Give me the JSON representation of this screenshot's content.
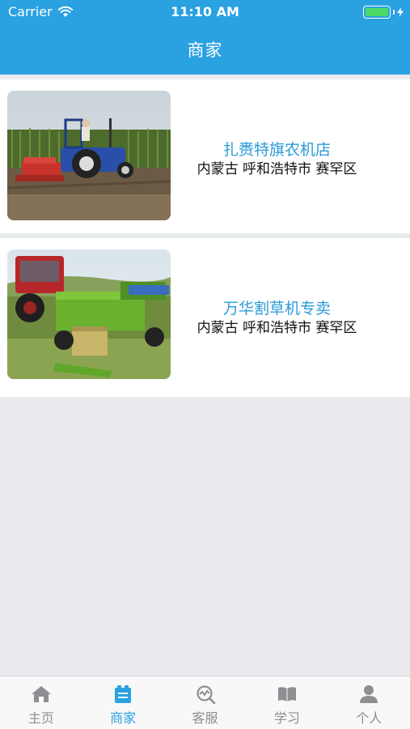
{
  "status_bar": {
    "carrier": "Carrier",
    "time": "11:10 AM"
  },
  "nav": {
    "title": "商家"
  },
  "shops": [
    {
      "name": "扎赉特旗农机店",
      "address": "内蒙古 呼和浩特市 赛罕区"
    },
    {
      "name": "万华割草机专卖",
      "address": "内蒙古 呼和浩特市 赛罕区"
    }
  ],
  "tabs": [
    {
      "label": "主页",
      "icon": "home-icon",
      "active": false
    },
    {
      "label": "商家",
      "icon": "merchant-icon",
      "active": true
    },
    {
      "label": "客服",
      "icon": "customer-service-icon",
      "active": false
    },
    {
      "label": "学习",
      "icon": "book-icon",
      "active": false
    },
    {
      "label": "个人",
      "icon": "person-icon",
      "active": false
    }
  ],
  "colors": {
    "accent": "#2aa1e1",
    "shop_name": "#2a9ad8",
    "tab_inactive": "#8e8e93",
    "background": "#e9e9ee"
  }
}
